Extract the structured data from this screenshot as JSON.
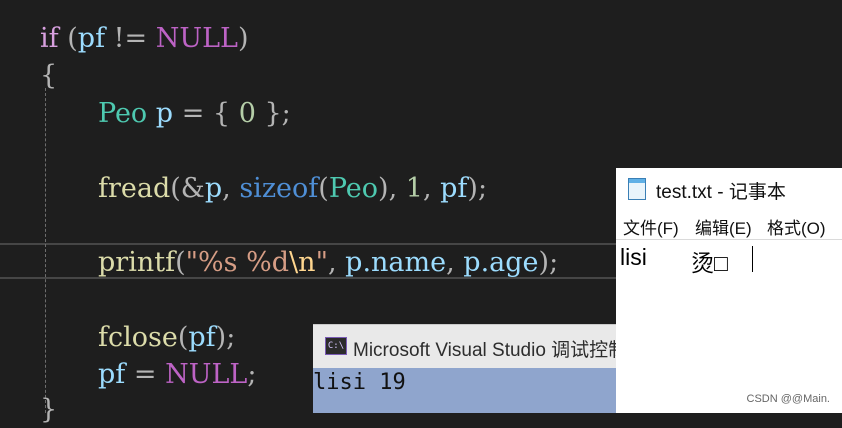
{
  "code": {
    "l1": {
      "if": "if",
      "open": "(",
      "pf": "pf",
      "neq": "!=",
      "null": "NULL",
      "close": ")"
    },
    "l2": {
      "brace": "{"
    },
    "l3": {
      "type": "Peo",
      "var": "p",
      "eq": "=",
      "lb": "{",
      "zero": "0",
      "rb": "};"
    },
    "l4": {
      "fread": "fread",
      "open": "(&",
      "p": "p",
      "comma1": ",",
      "sizeof": "sizeof",
      "po": "(",
      "peo": "Peo",
      "pc": "),",
      "one": "1",
      "comma2": ",",
      "pf": "pf",
      "end": ");"
    },
    "l5": {
      "printf": "printf",
      "open": "(",
      "fmt": "\"%s %d",
      "esc": "\\n",
      "q": "\"",
      "comma1": ",",
      "pname": "p.name",
      "comma2": ",",
      "page": "p.age",
      "end": ");"
    },
    "l6": {
      "fclose": "fclose",
      "open": "(",
      "pf": "pf",
      "end": ");"
    },
    "l7": {
      "pf": "pf",
      "eq": "=",
      "null": "NULL",
      "semi": ";"
    },
    "l8": {
      "brace": "}"
    }
  },
  "console": {
    "icon": "C:\\",
    "title": "Microsoft Visual Studio 调试控制台",
    "output": "lisi 19"
  },
  "notepad": {
    "title": "test.txt - 记事本",
    "menu": [
      "文件(F)",
      "编辑(E)",
      "格式(O)"
    ],
    "text_name": "lisi",
    "text_garbled": "烫□"
  },
  "watermark": "CSDN @@Main."
}
